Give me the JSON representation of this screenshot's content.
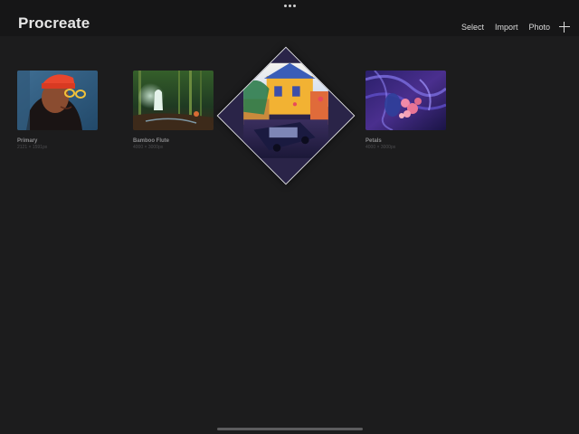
{
  "app": {
    "title": "Procreate"
  },
  "toolbar": {
    "select_label": "Select",
    "import_label": "Import",
    "photo_label": "Photo",
    "new_icon": "plus-icon"
  },
  "gallery": {
    "items": [
      {
        "name": "Primary",
        "size": "2121 × 1591px"
      },
      {
        "name": "Bamboo Flute",
        "size": "4000 × 3000px"
      },
      {
        "name": "Petals",
        "size": "4000 × 3000px"
      }
    ]
  },
  "colors": {
    "background": "#1c1c1d",
    "topbar": "#161617",
    "title": "#e6e6e6"
  }
}
